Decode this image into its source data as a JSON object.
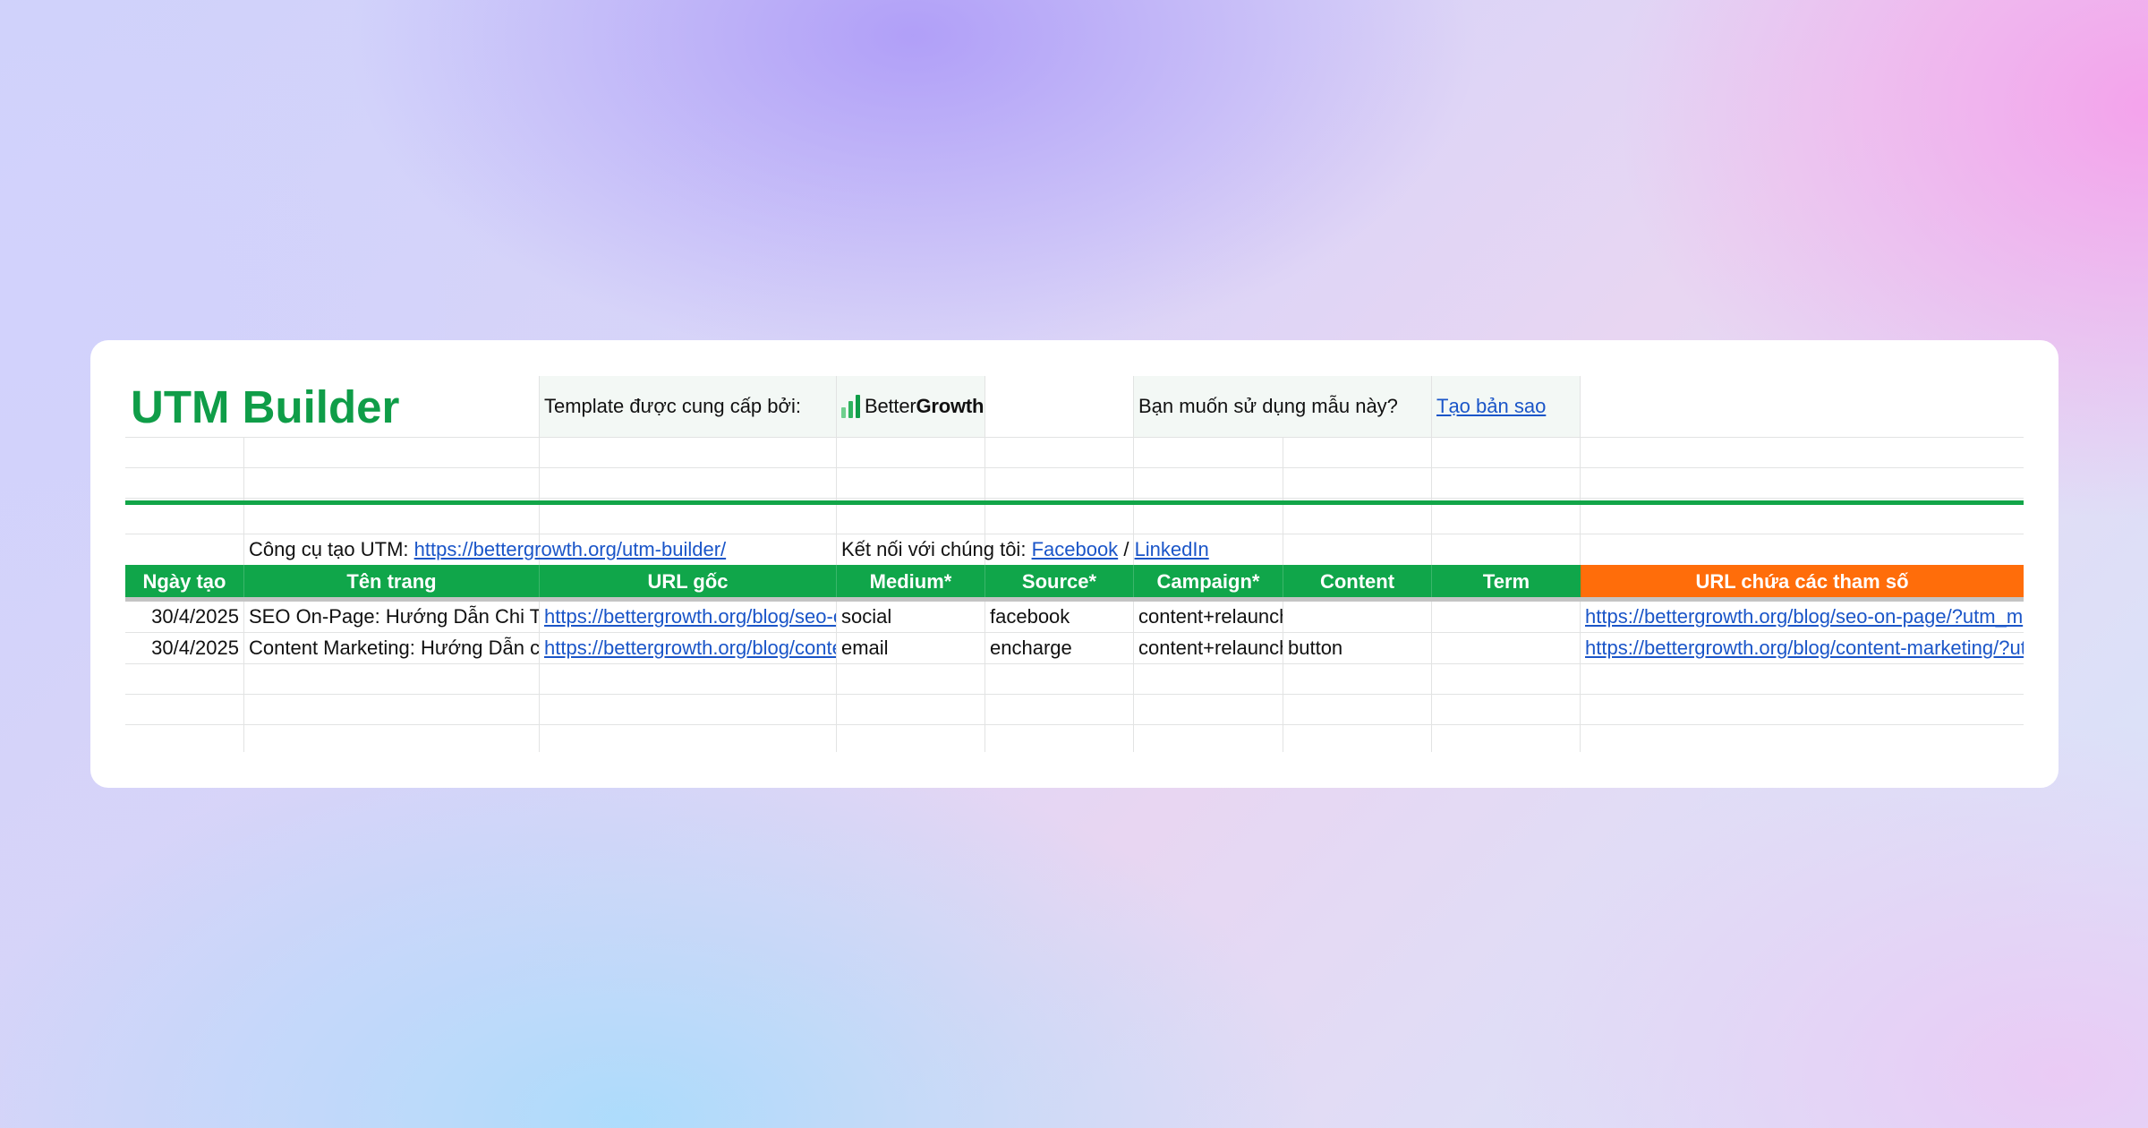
{
  "title": "UTM Builder",
  "template_by_label": "Template được cung cấp bởi:",
  "brand": {
    "prefix": "Better",
    "suffix": "Growth",
    "icon": "bar-growth-icon"
  },
  "copy_prompt": "Bạn muốn sử dụng mẫu này?",
  "copy_link": "Tạo bản sao",
  "tool_label": "Công cụ tạo UTM:",
  "tool_url": "https://bettergrowth.org/utm-builder/",
  "connect_label": "Kết nối với chúng tôi:",
  "social": {
    "facebook": "Facebook",
    "separator": "/",
    "linkedin": "LinkedIn"
  },
  "headers": [
    "Ngày tạo",
    "Tên trang",
    "URL gốc",
    "Medium*",
    "Source*",
    "Campaign*",
    "Content",
    "Term",
    "URL chứa các tham số"
  ],
  "rows": [
    {
      "date": "30/4/2025",
      "page": "SEO On-Page: Hướng Dẫn Chi T",
      "url": "https://bettergrowth.org/blog/seo-o",
      "medium": "social",
      "source": "facebook",
      "campaign": "content+relaunch",
      "content": "",
      "term": "",
      "final_url": "https://bettergrowth.org/blog/seo-on-page/?utm_m"
    },
    {
      "date": "30/4/2025",
      "page": "Content Marketing: Hướng Dẫn c",
      "url": "https://bettergrowth.org/blog/conte",
      "medium": "email",
      "source": "encharge",
      "campaign": "content+relaunch",
      "content": "button",
      "term": "",
      "final_url": "https://bettergrowth.org/blog/content-marketing/?ut"
    }
  ],
  "colors": {
    "title": "#0f9d48",
    "header_green": "#10a64a",
    "header_orange": "#ff6d0a",
    "green_rule": "#12a548",
    "link": "#1a55c8"
  }
}
